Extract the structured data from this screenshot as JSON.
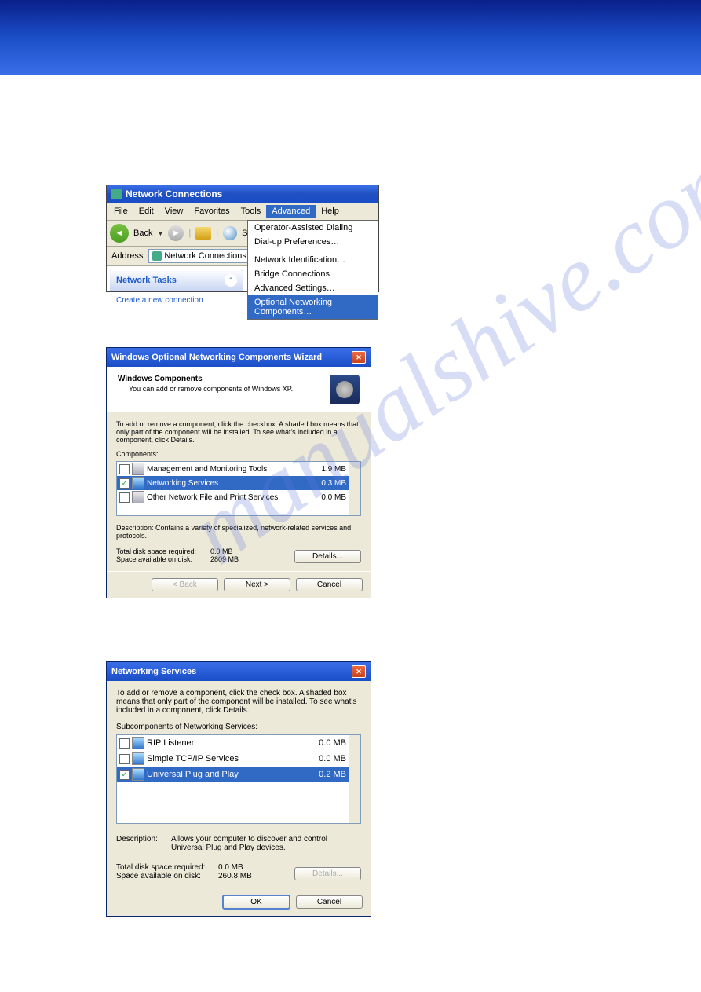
{
  "banner": {},
  "screenshot1": {
    "title": "Network Connections",
    "menu": {
      "file": "File",
      "edit": "Edit",
      "view": "View",
      "favorites": "Favorites",
      "tools": "Tools",
      "advanced": "Advanced",
      "help": "Help"
    },
    "toolbar": {
      "back": "Back",
      "search_prefix": "Se"
    },
    "address_label": "Address",
    "address_value": "Network Connections",
    "dropdown": {
      "item1": "Operator-Assisted Dialing",
      "item2": "Dial-up Preferences…",
      "item3": "Network Identification…",
      "item4": "Bridge Connections",
      "item5": "Advanced Settings…",
      "item6": "Optional Networking Components…"
    },
    "sidebar": {
      "head": "Network Tasks",
      "item1": "Create a new connection"
    }
  },
  "screenshot2": {
    "title": "Windows Optional Networking Components Wizard",
    "heading": "Windows Components",
    "subheading": "You can add or remove components of Windows XP.",
    "instructions": "To add or remove a component, click the checkbox. A shaded box means that only part of the component will be installed. To see what's included in a component, click Details.",
    "components_label": "Components:",
    "rows": [
      {
        "name": "Management and Monitoring Tools",
        "size": "1.9 MB"
      },
      {
        "name": "Networking Services",
        "size": "0.3 MB"
      },
      {
        "name": "Other Network File and Print Services",
        "size": "0.0 MB"
      }
    ],
    "description_label": "Description:",
    "description": "Contains a variety of specialized, network-related services and protocols.",
    "disk_required_label": "Total disk space required:",
    "disk_required": "0.0 MB",
    "disk_available_label": "Space available on disk:",
    "disk_available": "2809 MB",
    "details_btn": "Details...",
    "back_btn": "< Back",
    "next_btn": "Next >",
    "cancel_btn": "Cancel"
  },
  "screenshot3": {
    "title": "Networking Services",
    "instructions": "To add or remove a component, click the check box. A shaded box means that only part of the component will be installed. To see what's included in a component, click Details.",
    "sub_label": "Subcomponents of Networking Services:",
    "rows": [
      {
        "name": "RIP Listener",
        "size": "0.0 MB"
      },
      {
        "name": "Simple TCP/IP Services",
        "size": "0.0 MB"
      },
      {
        "name": "Universal Plug and Play",
        "size": "0.2 MB"
      }
    ],
    "description_label": "Description:",
    "description": "Allows your computer to discover and control Universal Plug and Play devices.",
    "disk_required_label": "Total disk space required:",
    "disk_required": "0.0 MB",
    "disk_available_label": "Space available on disk:",
    "disk_available": "260.8 MB",
    "details_btn": "Details...",
    "ok_btn": "OK",
    "cancel_btn": "Cancel"
  }
}
